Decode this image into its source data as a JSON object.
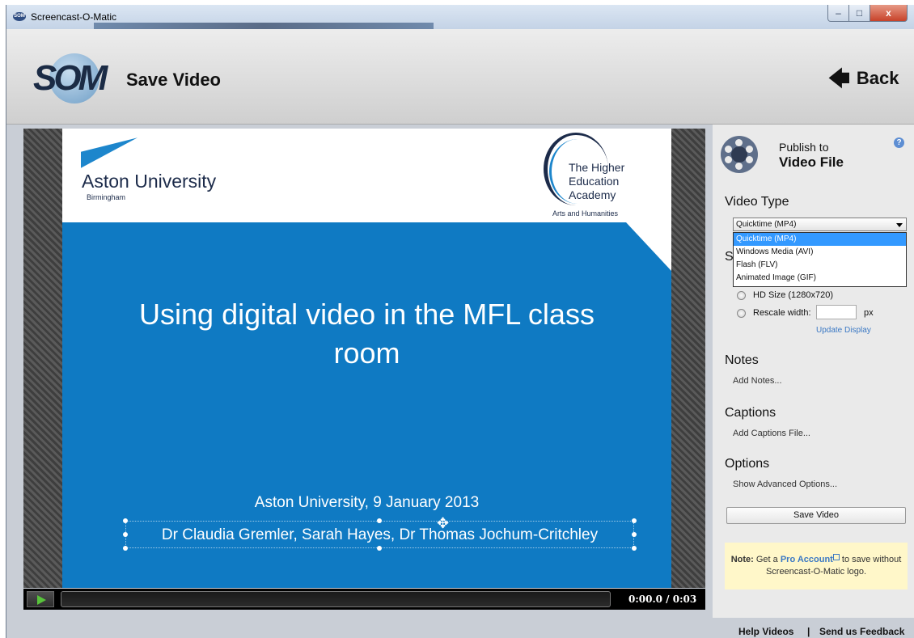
{
  "window": {
    "title": "Screencast-O-Matic",
    "app_icon_text": "SOM",
    "minimize": "–",
    "maximize": "□",
    "close": "x"
  },
  "header": {
    "logo_text": "SOM",
    "title": "Save Video",
    "back_label": "Back",
    "back_icon": "arrow-left-icon"
  },
  "slide": {
    "institution": "Aston University",
    "city": "Birmingham",
    "hea_logo": [
      "The Higher",
      "Education",
      "Academy",
      "Arts and Humanities"
    ],
    "title": "Using digital video in the MFL class room",
    "subtitle": "Aston University, 9 January 2013",
    "authors": "Dr Claudia Gremler, Sarah Hayes, Dr Thomas Jochum-Critchley"
  },
  "player": {
    "time": "0:00.0 / 0:03",
    "progress": 0
  },
  "side": {
    "publish_label": "Publish to",
    "publish_target": "Video File",
    "help_icon": "?",
    "video_type_heading": "Video Type",
    "video_type_selected": "Quicktime (MP4)",
    "video_type_options": [
      "Quicktime (MP4)",
      "Windows Media (AVI)",
      "Flash (FLV)",
      "Animated Image (GIF)"
    ],
    "size_heading_peek": "S",
    "hd_size_label": "HD Size (1280x720)",
    "rescale_label": "Rescale width:",
    "rescale_value": "",
    "px_label": "px",
    "update_display": "Update Display",
    "notes_heading": "Notes",
    "add_notes": "Add Notes...",
    "captions_heading": "Captions",
    "add_captions": "Add Captions File...",
    "options_heading": "Options",
    "advanced_options": "Show Advanced Options...",
    "save_button": "Save Video",
    "note": {
      "bold": "Note:",
      "text1": "Get a",
      "link": "Pro Account",
      "text2": "to save without Screencast-O-Matic logo."
    }
  },
  "footer": {
    "help_videos": "Help Videos",
    "separator": "|",
    "feedback": "Send us Feedback"
  },
  "colors": {
    "slide_blue": "#0f7ac3",
    "link_blue": "#3a78c4",
    "dropdown_highlight": "#3399ff",
    "note_bg": "#fff7c9"
  }
}
